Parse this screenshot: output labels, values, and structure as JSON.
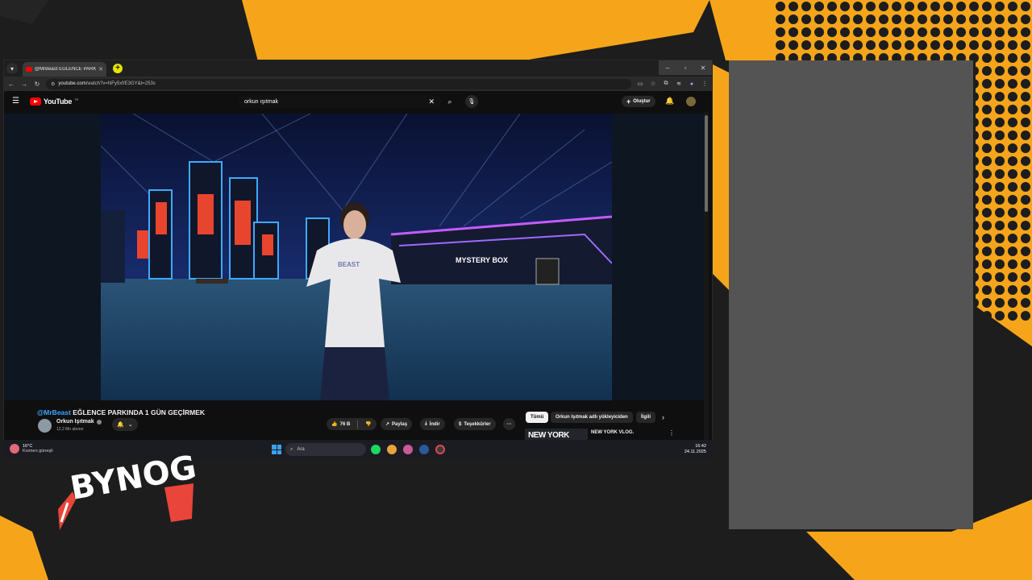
{
  "browser": {
    "tab_title": "@MrBeast EĞLENCE PARKINDA",
    "url_host": "youtube.com",
    "url_path": "/watch?v=NFy5xf/E3GY&t=253s",
    "window_buttons": [
      "–",
      "▫",
      "✕"
    ]
  },
  "youtube": {
    "logo_text": "YouTube",
    "logo_country": "TR",
    "search_value": "orkun ışıtmak",
    "create_label": "Oluştur",
    "video": {
      "title_mention": "@MrBeast",
      "title_rest": " EĞLENCE PARKINDA 1 GÜN GEÇİRMEK",
      "channel_name": "Orkun Işıtmak",
      "subscribers": "12,2 Mn abone",
      "likes": "76 B",
      "share_label": "Paylaş",
      "download_label": "İndir",
      "thanks_label": "Teşekkürler",
      "scene_sign": "MYSTERY BOX"
    },
    "chips": [
      "Tümü",
      "Orkun Işıtmak adlı yükleyiciden",
      "İlgili"
    ],
    "recommendation": {
      "thumb_text": "NEW YORK",
      "title": "NEW YORK VLOG."
    }
  },
  "taskbar": {
    "temp": "16°C",
    "condition": "Kısmen güneşli",
    "search_placeholder": "Ara",
    "time": "16:42",
    "date": "24.11.2025"
  },
  "brand_logo": "BYNOG",
  "colors": {
    "accent_orange": "#f6a51b",
    "youtube_red": "#ff0000",
    "link_blue": "#3ea6ff",
    "panel_gray": "#545454"
  }
}
